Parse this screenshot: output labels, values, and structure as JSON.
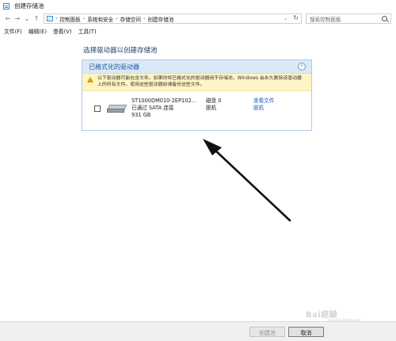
{
  "window": {
    "title": "创建存储池"
  },
  "nav": {
    "back": "←",
    "forward": "→",
    "dropdown": "⌄",
    "up": "↑"
  },
  "address": {
    "crumbs": [
      "控制面板",
      "系统和安全",
      "存储空间",
      "创建存储池"
    ],
    "dropdown": "⌄",
    "refresh": "↻"
  },
  "search": {
    "placeholder": "搜索控制面板"
  },
  "menu": {
    "items": [
      "文件(F)",
      "编辑(E)",
      "查看(V)",
      "工具(T)"
    ]
  },
  "heading": "选择驱动器以创建存储池",
  "panel": {
    "title": "已格式化的驱动器",
    "collapse": "⌃",
    "warning_line1": "以下驱动器可能包含文件。如果你将已格式化的驱动器用于存储池，Windows 会永久删除该驱动器",
    "warning_line2": "上的所有文件。使用这些驱动器前请备份这些文件。"
  },
  "drive": {
    "name": "ST1000DM010-2EP102...",
    "connection": "已通过 SATA 连接",
    "size": "931 GB",
    "disk": "磁盘 0",
    "status": "脱机",
    "link_view": "查看文件",
    "link_offline": "脱机"
  },
  "buttons": {
    "create": "创建池",
    "cancel": "取消"
  },
  "watermark": {
    "main": "Bai經驗",
    "sub": "jingyan.baidu.com"
  },
  "colors": {
    "accent": "#1e5aa6",
    "warning_bg": "#fff4c4",
    "panel_header_bg": "#dbe9f7",
    "link": "#1a5fb4"
  }
}
